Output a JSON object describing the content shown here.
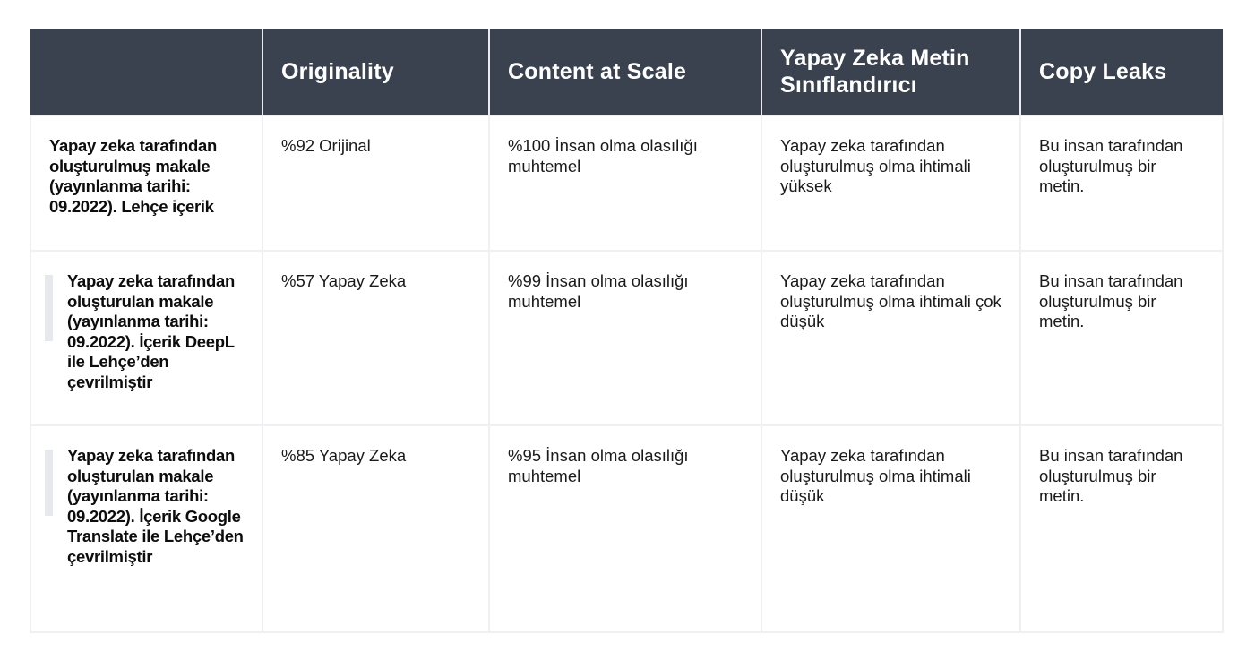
{
  "table": {
    "headers": [
      "",
      "Originality",
      "Content at Scale",
      "Yapay Zeka Metin Sınıflandırıcı",
      "Copy Leaks"
    ],
    "rows": [
      {
        "label": "Yapay zeka tarafından oluşturulmuş makale (yayınlanma tarihi: 09.2022). Lehçe içerik",
        "originality": "%92 Orijinal",
        "content_at_scale": "%100 İnsan olma olasılığı muhtemel",
        "ai_text_classifier": "Yapay zeka tarafından oluşturulmuş olma ihtimali yüksek",
        "copy_leaks": "Bu insan tarafından oluşturulmuş bir metin."
      },
      {
        "label": "Yapay zeka tarafından oluşturulan makale (yayınlanma tarihi: 09.2022). İçerik DeepL ile Lehçe’den çevrilmiştir",
        "originality": "%57 Yapay Zeka",
        "content_at_scale": "%99 İnsan olma olasılığı muhtemel",
        "ai_text_classifier": "Yapay zeka tarafından oluşturulmuş olma ihtimali çok düşük",
        "copy_leaks": "Bu insan tarafından oluşturulmuş bir metin."
      },
      {
        "label": "Yapay zeka tarafından oluşturulan makale (yayınlanma tarihi: 09.2022). İçerik Google Translate ile Lehçe’den çevrilmiştir",
        "originality": "%85 Yapay Zeka",
        "content_at_scale": "%95 İnsan olma olasılığı muhtemel",
        "ai_text_classifier": "Yapay zeka tarafından oluşturulmuş olma ihtimali düşük",
        "copy_leaks": "Bu insan tarafından oluşturulmuş bir metin."
      }
    ]
  },
  "colors": {
    "header_background": "#3a414f",
    "header_text": "#ffffff",
    "grid_line": "#eef0f2",
    "quote_bar": "#e6e8ec"
  }
}
